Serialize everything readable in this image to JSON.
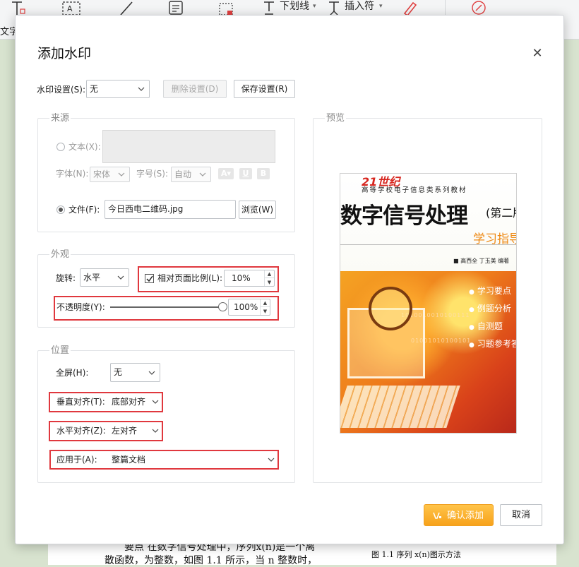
{
  "app": {
    "toolbar": {
      "underline_label": "下划线",
      "insert_symbol_label": "插入符",
      "side_label": "文字"
    },
    "document": {
      "body_line_1": "要点   在数字信号处理中，序列x(n)是一个离",
      "body_line_2": "散函数，为整数，如图 1.1 所示，当  n 整数时，",
      "figure_caption": "图 1.1   序列 x(n)图示方法"
    }
  },
  "dialog": {
    "title": "添加水印",
    "watermark_setting": {
      "label": "水印设置(S):",
      "value": "无",
      "delete_button": "删除设置(D)",
      "save_button": "保存设置(R)"
    },
    "source": {
      "group_label": "来源",
      "text_option_label": "文本(X):",
      "text_option_selected": false,
      "text_value": "",
      "font_label": "字体(N):",
      "font_value": "宋体",
      "size_label": "字号(S):",
      "size_value": "自动",
      "file_option_label": "文件(F):",
      "file_option_selected": true,
      "file_value": "今日西电二维码.jpg",
      "browse_button": "浏览(W)"
    },
    "appearance": {
      "group_label": "外观",
      "rotate_label": "旋转:",
      "rotate_value": "水平",
      "relative_scale_label": "相对页面比例(L):",
      "relative_scale_checked": true,
      "scale_value": "10%",
      "opacity_label": "不透明度(Y):",
      "opacity_value": "100%",
      "opacity_fraction": 1.0
    },
    "position": {
      "group_label": "位置",
      "fullscreen_label": "全屏(H):",
      "fullscreen_value": "无",
      "vertical_label": "垂直对齐(T):",
      "vertical_value": "底部对齐",
      "horizontal_label": "水平对齐(Z):",
      "horizontal_value": "左对齐",
      "apply_label": "应用于(A):",
      "apply_value": "整篇文档"
    },
    "preview": {
      "group_label": "预览",
      "cover": {
        "logo": "21世纪",
        "series": "高等学校电子信息类系列教材",
        "title": "数字信号处理",
        "edition": "(第二版",
        "subtitle": "学习指导",
        "authors": "■ 高西全  丁玉美  编著",
        "bullets": [
          "学习要点",
          "例题分析",
          "自测题",
          "习题参考答"
        ],
        "binary_1": "1010010010100111",
        "binary_2": "01001010100101"
      }
    },
    "confirm_button": "确认添加",
    "cancel_button": "取消"
  },
  "colors": {
    "highlight_red": "#e0383e",
    "primary_orange": "#f7a21b",
    "background_green": "#d8e3cf"
  }
}
